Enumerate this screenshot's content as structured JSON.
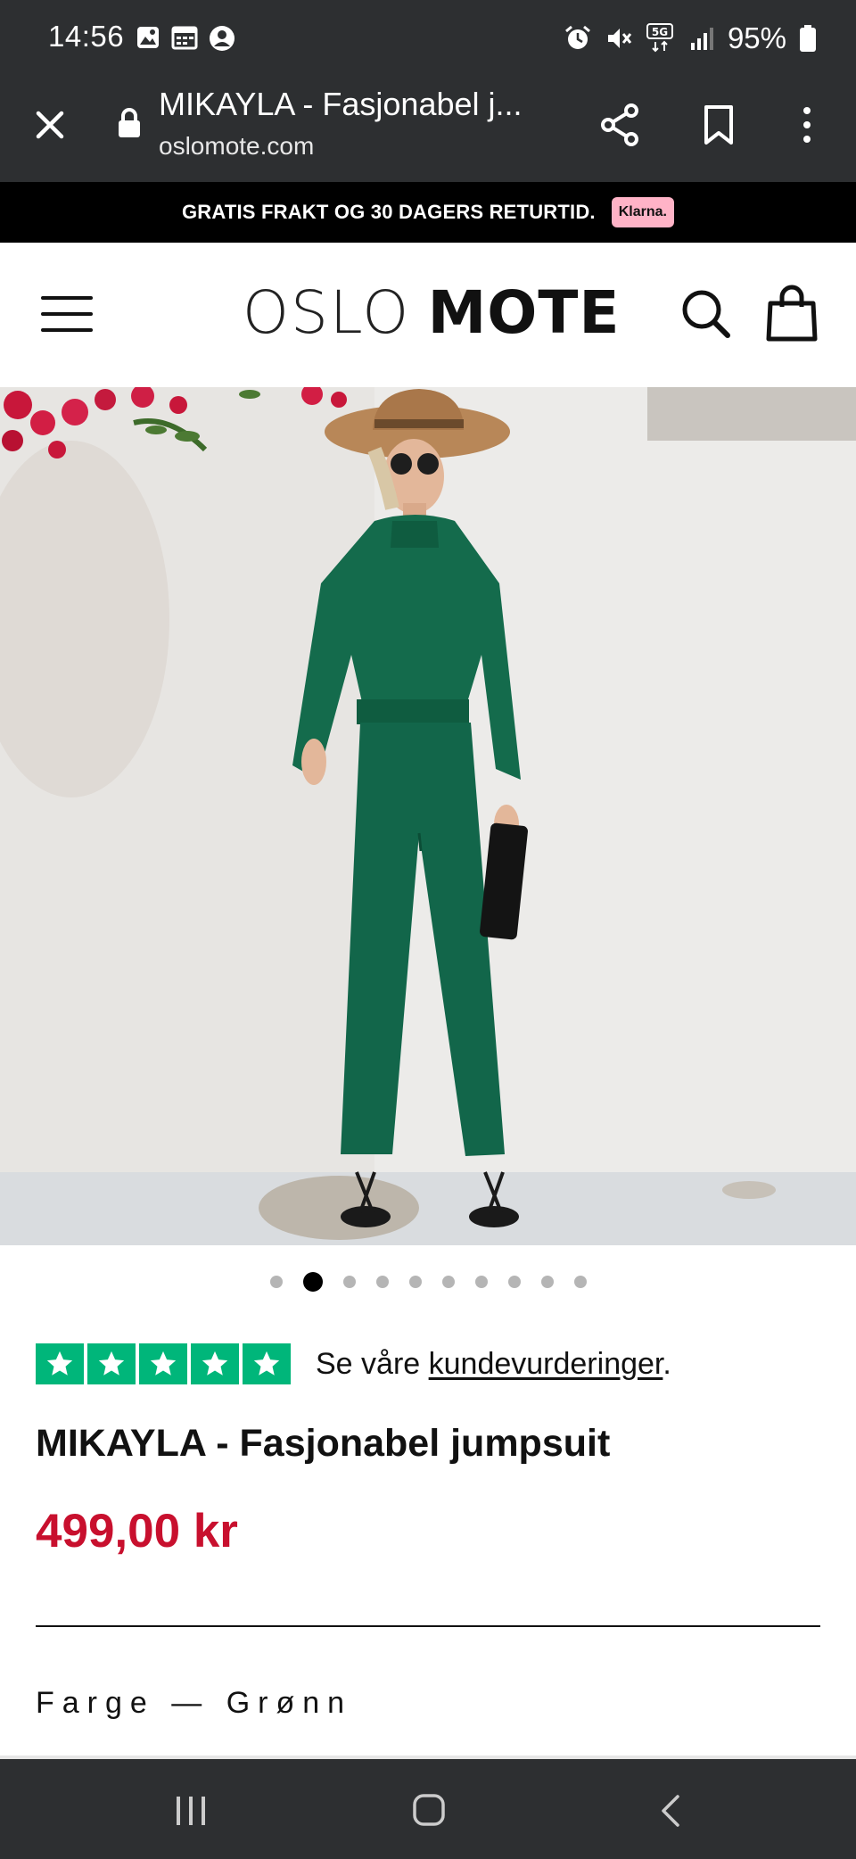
{
  "status_bar": {
    "time": "14:56",
    "network": "5G",
    "battery": "95%",
    "left_icons": [
      "image-icon",
      "calendar-icon",
      "account-icon"
    ],
    "right_icons": [
      "alarm-icon",
      "mute-icon",
      "network-5g-icon",
      "signal-icon",
      "battery-icon"
    ]
  },
  "browser": {
    "page_title": "MIKAYLA - Fasjonabel j...",
    "url": "oslomote.com",
    "icons": [
      "close-icon",
      "lock-icon",
      "share-icon",
      "bookmark-icon",
      "more-icon"
    ]
  },
  "promo": {
    "text": "GRATIS FRAKT OG 30 DAGERS RETURTID.",
    "badge": "Klarna."
  },
  "header": {
    "logo_light": "OSLO",
    "logo_bold": "MOTE",
    "icons": [
      "menu-icon",
      "search-icon",
      "shopping-bag-icon"
    ]
  },
  "product": {
    "image_alt": "Model wearing green jumpsuit",
    "image_index_active": 2,
    "image_count": 10,
    "review_prefix": "Se våre ",
    "review_link": "kundevurderinger",
    "review_suffix": ".",
    "rating": 5,
    "title": "MIKAYLA - Fasjonabel jumpsuit",
    "price": "499,00 kr",
    "color_label": "Farge",
    "color_separator": "—",
    "color_value": "Grønn"
  },
  "colors": {
    "bar_bg": "#2d2f31",
    "price_red": "#c8102e",
    "trustpilot_green": "#00b67a",
    "klarna_pink": "#ffb3c7",
    "jumpsuit_green": "#12664a"
  },
  "navbar": {
    "icons": [
      "recent-apps-icon",
      "home-icon",
      "back-icon"
    ]
  }
}
